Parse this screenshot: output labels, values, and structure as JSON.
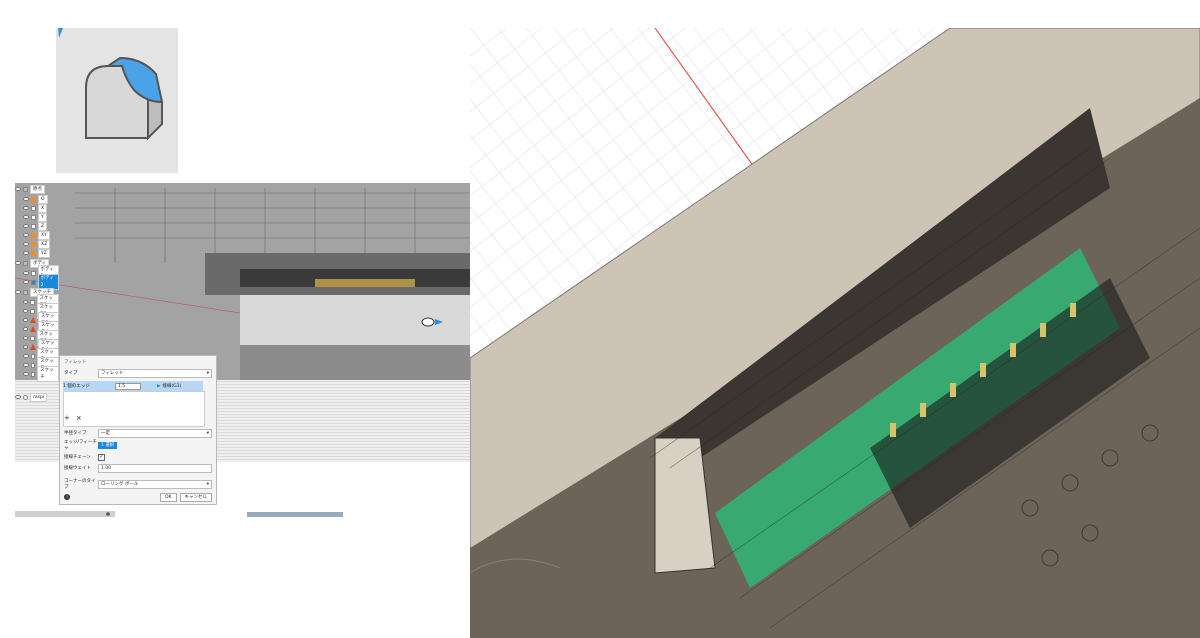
{
  "tree": [
    {
      "label": "原点",
      "kind": "folder"
    },
    {
      "label": "O",
      "kind": "origin"
    },
    {
      "label": "X",
      "kind": "axis"
    },
    {
      "label": "Y",
      "kind": "axis"
    },
    {
      "label": "Z",
      "kind": "axis"
    },
    {
      "label": "XY",
      "kind": "plane"
    },
    {
      "label": "XZ",
      "kind": "plane"
    },
    {
      "label": "YZ",
      "kind": "plane"
    },
    {
      "label": "ボディ",
      "kind": "folder"
    },
    {
      "label": "ボディ1",
      "kind": "body"
    },
    {
      "label": "ボディ2",
      "kind": "body-selected"
    },
    {
      "label": "スケッチ",
      "kind": "folder"
    },
    {
      "label": "スケッチ1",
      "kind": "sketch"
    },
    {
      "label": "スケッチ2",
      "kind": "sketch"
    },
    {
      "label": "スケッチ3",
      "kind": "sketch-warn"
    },
    {
      "label": "スケッチ4",
      "kind": "sketch-warn"
    },
    {
      "label": "スケッチ5",
      "kind": "sketch"
    },
    {
      "label": "スケッチ6",
      "kind": "sketch-warn"
    },
    {
      "label": "スケッチ",
      "kind": "sketch"
    },
    {
      "label": "スケッチ",
      "kind": "sketch"
    },
    {
      "label": "スケッチ",
      "kind": "sketch"
    },
    {
      "label": "raspi",
      "kind": "component"
    }
  ],
  "dialog": {
    "title": "フィレット",
    "type_label": "タイプ",
    "type_value": "フィレット",
    "edge_label": "1 個のエッジ",
    "edge_size": "1.5",
    "tangent_label": "接線(G1)",
    "add_symbol": "+",
    "remove_symbol": "×",
    "radius_type_label": "半径タイプ",
    "radius_type_value": "一定",
    "chain_label": "エッジ/フィーチャ",
    "chain_value": "1 選択",
    "tangent_chain_label": "接線チェーン",
    "tangent_weight_label": "接線ウェイト",
    "tangent_weight_value": "1.00",
    "corner_type_label": "コーナーのタイプ",
    "corner_type_value": "ローリング ボール",
    "info_symbol": "i",
    "ok_label": "OK",
    "cancel_label": "キャンセル"
  },
  "colors": {
    "accent": "#1a88d8",
    "tool_face": "#3b9be0",
    "viewport_tan": "#cdc4b5",
    "viewport_dark": "#6d6459",
    "pcb_green": "#2fb576",
    "axis_red": "#e53935"
  }
}
